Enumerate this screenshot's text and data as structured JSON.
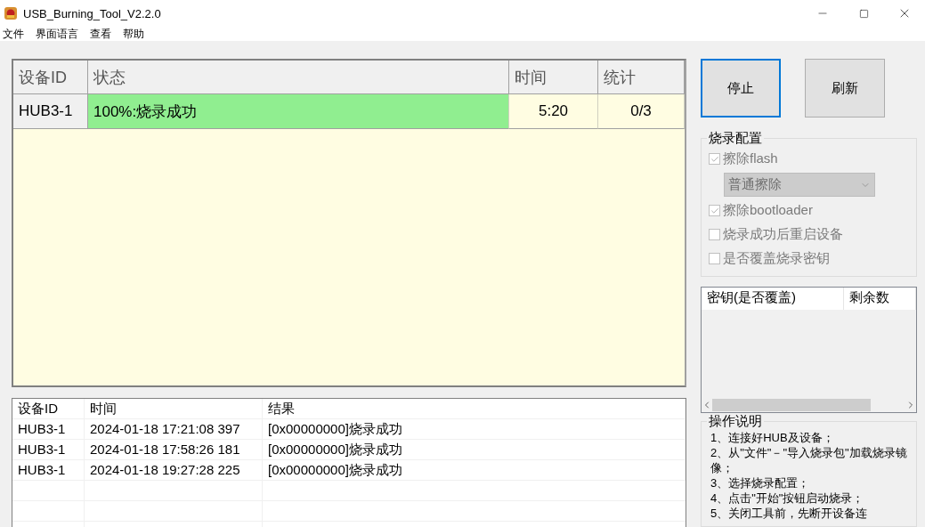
{
  "window": {
    "title": "USB_Burning_Tool_V2.2.0"
  },
  "menu": [
    "文件",
    "界面语言",
    "查看",
    "帮助"
  ],
  "device_table": {
    "columns": [
      "设备ID",
      "状态",
      "时间",
      "统计"
    ],
    "rows": [
      {
        "id": "HUB3-1",
        "status": "100%:烧录成功",
        "color": "#90ee90",
        "time": "5:20",
        "count": "0/3"
      }
    ]
  },
  "buttons": [
    {
      "label": "停止",
      "focused": true
    },
    {
      "label": "刷新",
      "focused": false
    }
  ],
  "config": {
    "title": "烧录配置",
    "options": [
      {
        "kind": "checkbox",
        "label": "擦除flash",
        "checked": true,
        "disabled": true
      },
      {
        "kind": "dropdown",
        "value": "普通擦除",
        "disabled": true
      },
      {
        "kind": "checkbox",
        "label": "擦除bootloader",
        "checked": true,
        "disabled": true
      },
      {
        "kind": "checkbox",
        "label": "烧录成功后重启设备",
        "checked": false,
        "disabled": true
      },
      {
        "kind": "checkbox",
        "label": "是否覆盖烧录密钥",
        "checked": false,
        "disabled": true
      }
    ]
  },
  "key_table": {
    "columns": [
      "密钥(是否覆盖)",
      "剩余数"
    ]
  },
  "log_table": {
    "columns": [
      "设备ID",
      "时间",
      "结果"
    ],
    "rows": [
      [
        "HUB3-1",
        "2024-01-18 17:21:08 397",
        "[0x00000000]烧录成功"
      ],
      [
        "HUB3-1",
        "2024-01-18 17:58:26 181",
        "[0x00000000]烧录成功"
      ],
      [
        "HUB3-1",
        "2024-01-18 19:27:28 225",
        "[0x00000000]烧录成功"
      ]
    ]
  },
  "instructions": {
    "title": "操作说明",
    "lines": [
      "1、连接好HUB及设备；",
      "2、从\"文件\"－\"导入烧录包\"加载烧录镜像；",
      "3、选择烧录配置；",
      "4、点击\"开始\"按钮启动烧录；",
      "5、关闭工具前，先断开设备连"
    ]
  }
}
